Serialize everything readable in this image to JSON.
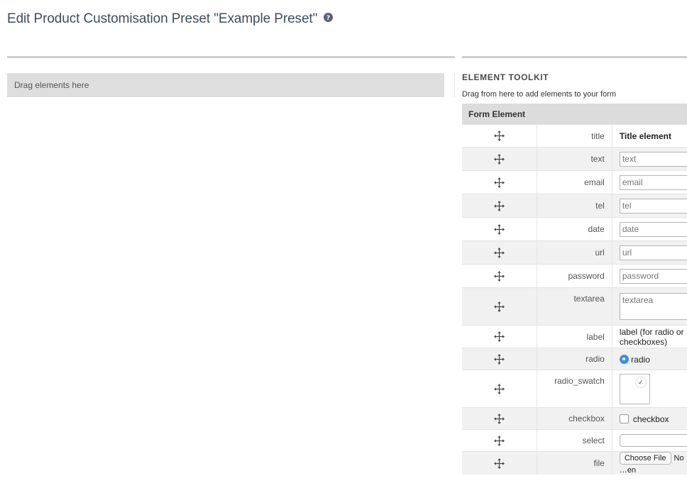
{
  "page": {
    "title": "Edit Product Customisation Preset \"Example Preset\""
  },
  "dropzone": {
    "label": "Drag elements here"
  },
  "toolkit": {
    "title": "ELEMENT TOOLKIT",
    "subtitle": "Drag from here to add elements to your form",
    "column_header": "Form Element",
    "rows": [
      {
        "name": "title",
        "display": "Title element"
      },
      {
        "name": "text",
        "placeholder": "text"
      },
      {
        "name": "email",
        "placeholder": "email"
      },
      {
        "name": "tel",
        "placeholder": "tel"
      },
      {
        "name": "date",
        "placeholder": "date"
      },
      {
        "name": "url",
        "placeholder": "url"
      },
      {
        "name": "password",
        "placeholder": "password"
      },
      {
        "name": "textarea",
        "placeholder": "textarea"
      },
      {
        "name": "label",
        "display": "label (for radio or checkboxes)"
      },
      {
        "name": "radio",
        "display": "radio"
      },
      {
        "name": "radio_swatch"
      },
      {
        "name": "checkbox",
        "display": "checkbox"
      },
      {
        "name": "select",
        "value": ""
      },
      {
        "name": "file",
        "button": "Choose File",
        "status": "No …en"
      }
    ]
  },
  "icons": {
    "help": "help-circle-icon",
    "drag": "move-arrows-icon",
    "swatch_check": "checkmark-icon"
  },
  "colors": {
    "title_text": "#3c4e5c",
    "radio_selected": "#3b8ff0",
    "table_header_bg": "#dcdcdc",
    "dropzone_bg": "#dedede"
  }
}
